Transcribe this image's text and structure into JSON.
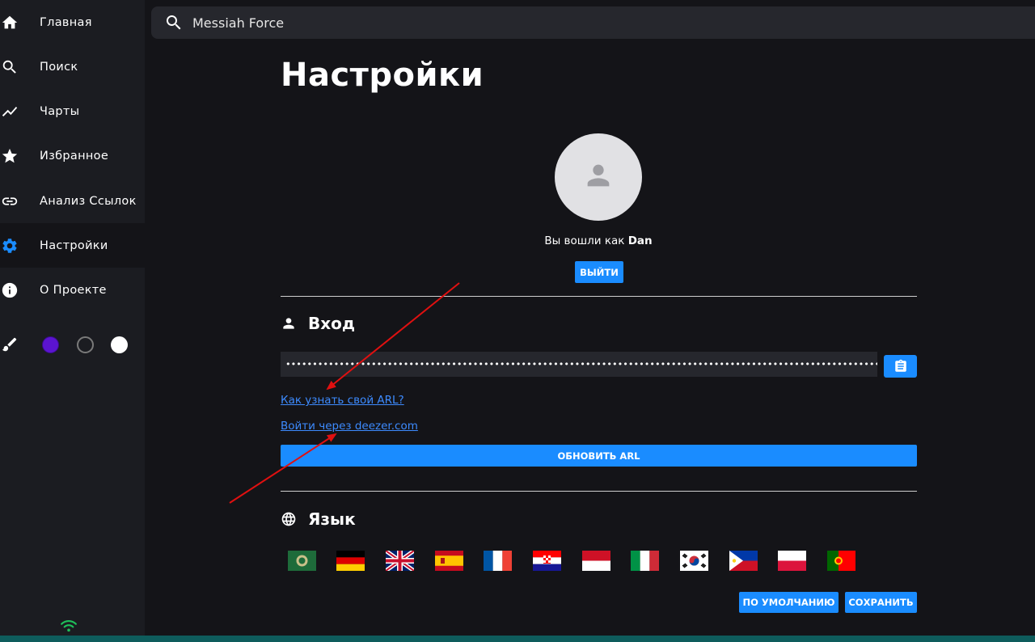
{
  "sidebar": {
    "items": [
      {
        "label": "Главная",
        "icon": "home-icon"
      },
      {
        "label": "Поиск",
        "icon": "search-icon"
      },
      {
        "label": "Чарты",
        "icon": "trending-icon"
      },
      {
        "label": "Избранное",
        "icon": "star-icon"
      },
      {
        "label": "Анализ Ссылок",
        "icon": "link-icon"
      },
      {
        "label": "Настройки",
        "icon": "gear-icon",
        "active": true
      },
      {
        "label": "О Проекте",
        "icon": "info-icon"
      }
    ],
    "theme_colors": [
      "#5b14d0",
      "#1b1c21",
      "#ffffff"
    ],
    "accent_color": "#1a8cff"
  },
  "search": {
    "value": "Messiah Force"
  },
  "settings": {
    "title": "Настройки",
    "logged_in_prefix": "Вы вошли как ",
    "username": "Dan",
    "logout_label": "ВЫЙТИ",
    "login_section_title": "Вход",
    "arl_value": "••••••••••••••••••••••••••••••••••••••••••••••••••••••••••••••••••••••••••••••••••••••••••••••••••••••••••••••••••••••••••••••••••••••••••••••••••••••••••••••••••••••••••••••••••••",
    "arl_help_link": "Как узнать свой ARL?",
    "login_deezer_link": "Войти через deezer.com",
    "update_arl_label": "ОБНОВИТЬ ARL",
    "language_section_title": "Язык",
    "languages": [
      "ar",
      "de",
      "en",
      "es",
      "fr",
      "hr",
      "id",
      "it",
      "ko",
      "ph",
      "pl",
      "pt"
    ],
    "default_label": "ПО УМОЛЧАНИЮ",
    "save_label": "СОХРАНИТЬ"
  }
}
